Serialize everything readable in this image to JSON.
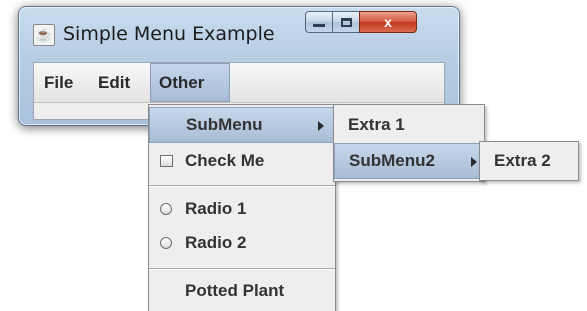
{
  "window": {
    "title": "Simple Menu Example",
    "app_icon": "java-cup-icon",
    "controls": {
      "minimize": "minimize-icon",
      "maximize": "maximize-icon",
      "close_label": "x"
    }
  },
  "menubar": {
    "items": [
      {
        "label": "File",
        "selected": false
      },
      {
        "label": "Edit",
        "selected": false
      },
      {
        "label": "Other",
        "selected": true
      }
    ]
  },
  "other_menu": {
    "items": [
      {
        "type": "submenu",
        "label": "SubMenu",
        "selected": true
      },
      {
        "type": "checkbox",
        "label": "Check Me",
        "checked": false
      },
      {
        "type": "radio",
        "label": "Radio 1",
        "checked": false
      },
      {
        "type": "radio",
        "label": "Radio 2",
        "checked": false
      },
      {
        "type": "item",
        "label": "Potted Plant"
      }
    ]
  },
  "submenu": {
    "items": [
      {
        "type": "item",
        "label": "Extra 1"
      },
      {
        "type": "submenu",
        "label": "SubMenu2",
        "selected": true
      }
    ]
  },
  "submenu2": {
    "items": [
      {
        "type": "item",
        "label": "Extra 2"
      }
    ]
  },
  "colors": {
    "selection": "#b3c6de",
    "menu_background": "#eeeeee",
    "close_button": "#c3391c"
  }
}
